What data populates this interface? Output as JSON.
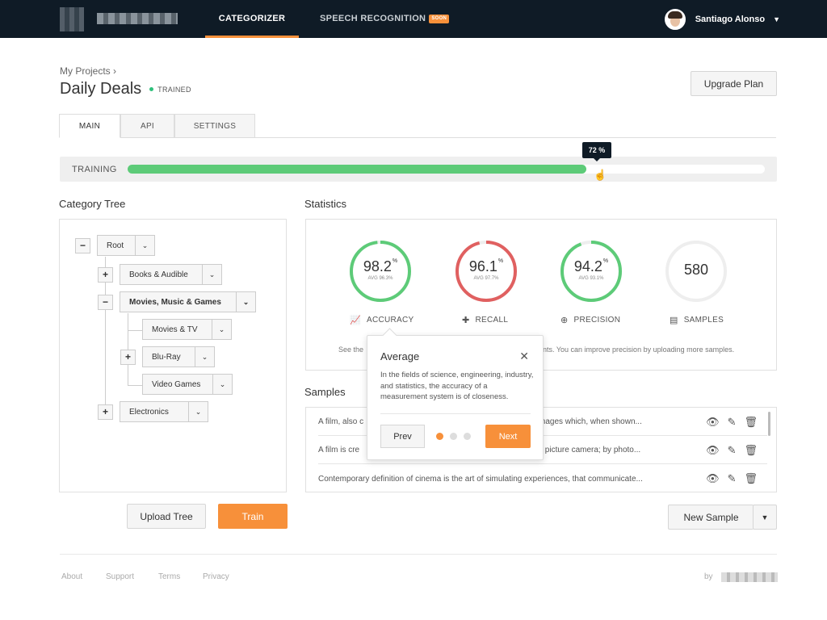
{
  "nav": {
    "items": [
      {
        "label": "CATEGORIZER"
      },
      {
        "label": "SPEECH RECOGNITION",
        "badge": "SOON"
      }
    ],
    "user_name": "Santiago Alonso"
  },
  "breadcrumb": "My Projects",
  "project": {
    "title": "Daily Deals",
    "status": "TRAINED"
  },
  "upgrade_label": "Upgrade Plan",
  "tabs": [
    {
      "label": "MAIN"
    },
    {
      "label": "API"
    },
    {
      "label": "SETTINGS"
    }
  ],
  "training": {
    "label": "TRAINING",
    "percent_label": "72 %",
    "progress": 0.72
  },
  "category_tree": {
    "heading": "Category Tree",
    "nodes": [
      {
        "label": "Root",
        "toggle": "−"
      },
      {
        "label": "Books & Audible",
        "toggle": "+"
      },
      {
        "label": "Movies, Music & Games",
        "toggle": "−"
      },
      {
        "label": "Movies & TV"
      },
      {
        "label": "Blu-Ray",
        "toggle": "+"
      },
      {
        "label": "Video Games"
      },
      {
        "label": "Electronics",
        "toggle": "+"
      }
    ],
    "upload_label": "Upload Tree",
    "train_label": "Train"
  },
  "statistics": {
    "heading": "Statistics",
    "items": [
      {
        "value": "98.2",
        "unit": "%",
        "avg": "AVG 96.3%",
        "label": "ACCURACY",
        "fraction": 0.982,
        "color": "#5dcb78"
      },
      {
        "value": "96.1",
        "unit": "%",
        "avg": "AVG 97.7%",
        "label": "RECALL",
        "fraction": 0.961,
        "color": "#e06060"
      },
      {
        "value": "94.2",
        "unit": "%",
        "avg": "AVG 93.1%",
        "label": "PRECISION",
        "fraction": 0.942,
        "color": "#5dcb78"
      },
      {
        "value": "580",
        "label": "SAMPLES"
      }
    ],
    "hint_left": "See the",
    "hint_right": "nts. You can improve precision by uploading more samples."
  },
  "samples": {
    "heading": "Samples",
    "rows": [
      {
        "left": "A film, also c",
        "right": "f still images which, when shown..."
      },
      {
        "left": "A film is cre",
        "right": "motion picture camera; by photo..."
      },
      {
        "text": "Contemporary definition of cinema is the art of simulating experiences, that communicate..."
      }
    ],
    "new_label": "New Sample"
  },
  "popup": {
    "title": "Average",
    "body": "In the fields of science, engineering, industry, and statistics, the accuracy of a measurement system is of closeness.",
    "prev": "Prev",
    "next": "Next",
    "active_step": 1,
    "steps": 3
  },
  "footer": {
    "links": [
      "About",
      "Support",
      "Terms",
      "Privacy"
    ],
    "by": "by"
  },
  "colors": {
    "accent": "#f7903a",
    "nav_bg": "#0f1b26",
    "success": "#5dcb78",
    "danger": "#e06060"
  }
}
